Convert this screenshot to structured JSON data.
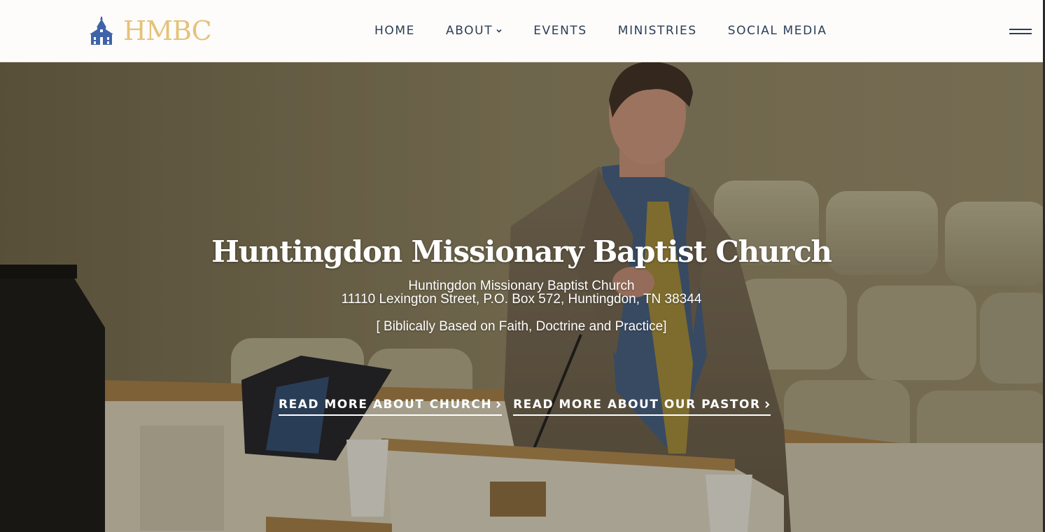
{
  "header": {
    "logo_text": "HMBC",
    "nav": [
      {
        "label": "HOME"
      },
      {
        "label": "ABOUT"
      },
      {
        "label": "EVENTS"
      },
      {
        "label": "MINISTRIES"
      },
      {
        "label": "SOCIAL MEDIA"
      }
    ]
  },
  "hero": {
    "title": "Huntingdon Missionary Baptist Church",
    "church_name": "Huntingdon Missionary Baptist Church",
    "address": "11110 Lexington Street, P.O. Box 572, Huntingdon, TN 38344",
    "tagline": "[ Biblically Based on Faith, Doctrine and Practice]",
    "cta_church": "READ MORE ABOUT CHURCH",
    "cta_pastor": "READ MORE ABOUT OUR PASTOR"
  },
  "colors": {
    "logo_gold": "#e5c27a",
    "logo_icon_blue": "#3f63a8",
    "nav_text": "#2c3e55",
    "hero_text": "#ffffff"
  },
  "icons": {
    "logo": "church-icon",
    "about_dropdown": "chevron-down-icon",
    "menu": "hamburger-menu-icon",
    "cta": "chevron-right-icon"
  }
}
